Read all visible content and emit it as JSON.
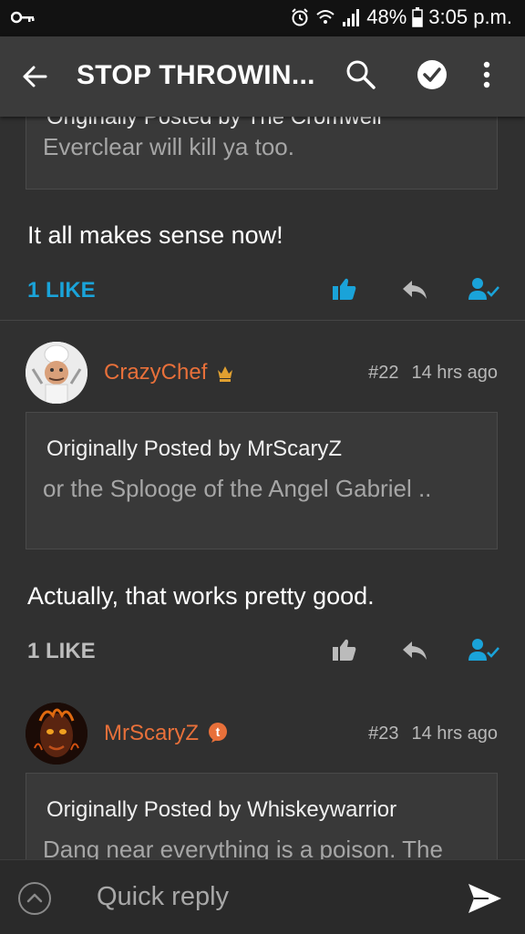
{
  "status_bar": {
    "battery": "48%",
    "time": "3:05 p.m."
  },
  "app_bar": {
    "title": "STOP THROWIN..."
  },
  "posts": [
    {
      "quote_by": "Originally Posted by The Cromwell",
      "quote_text": "Everclear will kill ya too.",
      "body": "It all makes sense now!",
      "likes": "1 LIKE",
      "liked": true
    },
    {
      "username": "CrazyChef",
      "badge": "crown-icon",
      "number": "#22",
      "time": "14 hrs ago",
      "quote_by": "Originally Posted by MrScaryZ",
      "quote_text": "or the Splooge of the Angel Gabriel ..",
      "body": "Actually, that works pretty good.",
      "likes": "1 LIKE",
      "liked": false
    },
    {
      "username": "MrScaryZ",
      "badge": "t-badge-icon",
      "badge_letter": "t",
      "number": "#23",
      "time": "14 hrs ago",
      "quote_by": "Originally Posted by Whiskeywarrior",
      "quote_text": "Dang near everything is a poison. The"
    }
  ],
  "composer": {
    "placeholder": "Quick reply"
  },
  "colors": {
    "accent_blue": "#1aa3d9",
    "username_orange": "#e8703a",
    "background": "#303030",
    "app_bar": "#3b3b3b"
  }
}
